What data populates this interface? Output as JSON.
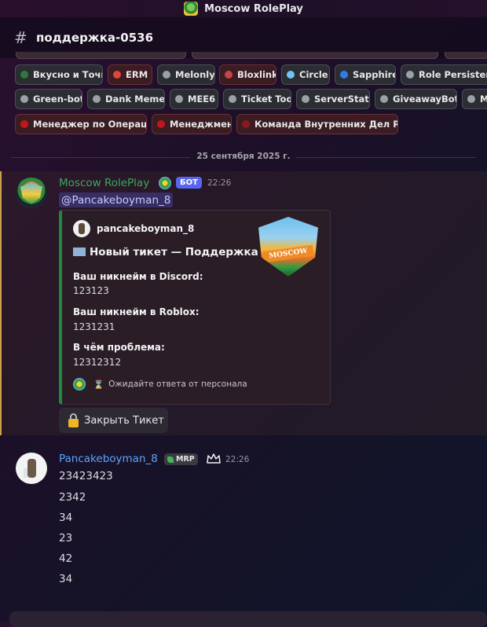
{
  "window": {
    "title": "Moscow RolePlay"
  },
  "channel": {
    "name": "поддержка-0536"
  },
  "tags": {
    "row1": [
      {
        "label": "Вкусно и Точка",
        "dot": "#2d7a3a",
        "style": "gray"
      },
      {
        "label": "ERM",
        "dot": "#e0453a",
        "style": "red"
      },
      {
        "label": "Melonly",
        "dot": "#9aa0a8",
        "style": "gray"
      },
      {
        "label": "Bloxlink",
        "dot": "#c9434a",
        "style": "red"
      },
      {
        "label": "Circle",
        "dot": "#6fc4f2",
        "style": "gray"
      },
      {
        "label": "Sapphire",
        "dot": "#2f7ce8",
        "style": "gray"
      },
      {
        "label": "Role Persistence",
        "dot": "#9aa0a8",
        "style": "gray"
      }
    ],
    "row2": [
      {
        "label": "Green-bot",
        "dot": "#9aa0a8",
        "style": "gray"
      },
      {
        "label": "Dank Memer",
        "dot": "#9aa0a8",
        "style": "gray"
      },
      {
        "label": "MEE6",
        "dot": "#9aa0a8",
        "style": "gray"
      },
      {
        "label": "Ticket Tool",
        "dot": "#9aa0a8",
        "style": "gray"
      },
      {
        "label": "ServerStats",
        "dot": "#9aa0a8",
        "style": "gray"
      },
      {
        "label": "GiveawayBot",
        "dot": "#9aa0a8",
        "style": "gray"
      },
      {
        "label": "Me",
        "dot": "#9aa0a8",
        "style": "gray"
      }
    ],
    "row3": [
      {
        "label": "Менеджер по Операциям",
        "dot": "#c3161c",
        "style": "red"
      },
      {
        "label": "Менеджмент",
        "dot": "#c3161c",
        "style": "red"
      },
      {
        "label": "Команда Внутренних Дел Roblox",
        "dot": "#8a1a1a",
        "style": "red"
      }
    ]
  },
  "date_divider": "25 сентября 2025 г.",
  "bot_message": {
    "author": "Moscow RolePlay",
    "badge": "БОТ",
    "time": "22:26",
    "mention": "@Pancakeboyman_8",
    "embed": {
      "author": "pancakeboyman_8",
      "title": "Новый тикет — Поддержка",
      "fields": [
        {
          "name": "Ваш никнейм в Discord:",
          "value": "123123"
        },
        {
          "name": "Ваш никнейм в Roblox:",
          "value": "1231231"
        },
        {
          "name": "В чём проблема:",
          "value": "12312312"
        }
      ],
      "footer": "Ожидайте ответа от персонала",
      "thumb_text": "MOSCOW",
      "accent": "#1f8a3b"
    },
    "button": "Закрыть Тикет"
  },
  "user_message": {
    "author": "Pancakeboyman_8",
    "tag": "MRP",
    "time": "22:26",
    "lines": [
      "23423423",
      "2342",
      "34",
      "23",
      "42",
      "34"
    ]
  }
}
